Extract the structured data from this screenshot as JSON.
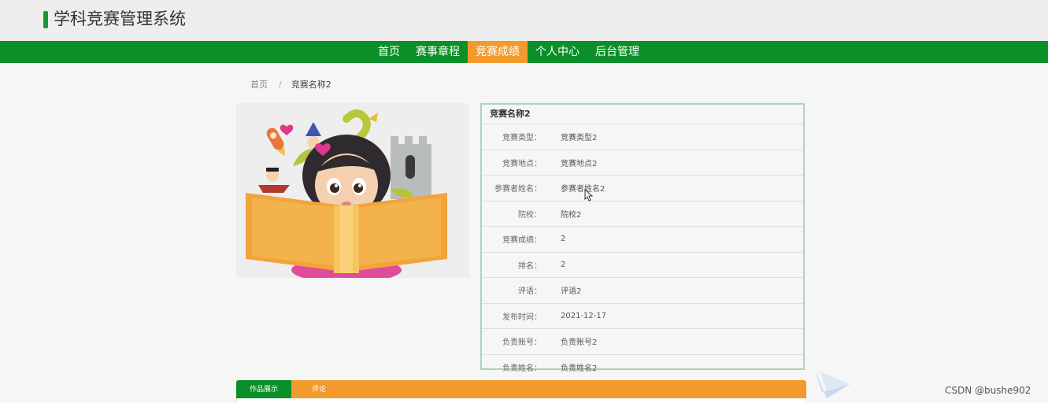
{
  "header": {
    "title": "学科竞赛管理系统"
  },
  "nav": {
    "items": [
      {
        "label": "首页"
      },
      {
        "label": "赛事章程"
      },
      {
        "label": "竞赛成绩"
      },
      {
        "label": "个人中心"
      },
      {
        "label": "后台管理"
      }
    ]
  },
  "breadcrumb": {
    "home": "首页",
    "separator": "/",
    "current": "竞赛名称2"
  },
  "detail": {
    "title": "竞赛名称2",
    "rows": [
      {
        "label": "竞赛类型：",
        "value": "竞赛类型2"
      },
      {
        "label": "竞赛地点：",
        "value": "竞赛地点2"
      },
      {
        "label": "参赛者姓名：",
        "value": "参赛者姓名2"
      },
      {
        "label": "院校：",
        "value": "院校2"
      },
      {
        "label": "竞赛成绩：",
        "value": "2"
      },
      {
        "label": "排名：",
        "value": "2"
      },
      {
        "label": "评语：",
        "value": "评语2"
      },
      {
        "label": "发布时间：",
        "value": "2021-12-17"
      },
      {
        "label": "负责账号：",
        "value": "负责账号2"
      },
      {
        "label": "负责姓名：",
        "value": "负责姓名2"
      }
    ]
  },
  "tabs": [
    {
      "label": "作品展示"
    },
    {
      "label": "评论"
    }
  ],
  "watermark": "CSDN @bushe902",
  "colors": {
    "nav_green": "#0b8f28",
    "active_orange": "#f39a2c",
    "panel_border": "#a8d6b8"
  },
  "image_icon": "girl-reading-book-illustration"
}
